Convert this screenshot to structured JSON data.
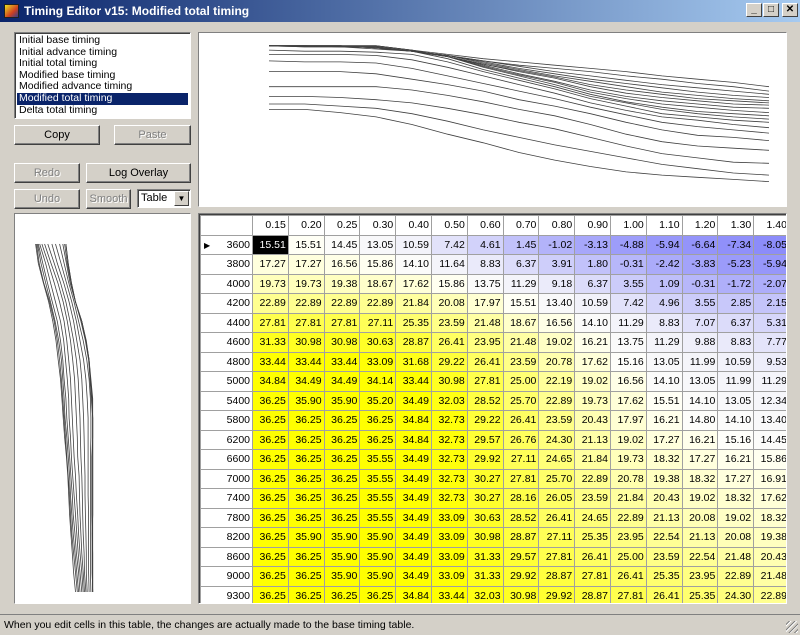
{
  "window": {
    "title": "Timing Editor v15: Modified total timing",
    "minimize_label": "_",
    "maximize_label": "□",
    "close_label": "✕"
  },
  "list": {
    "items": [
      {
        "label": "Initial base timing",
        "selected": false
      },
      {
        "label": "Initial advance timing",
        "selected": false
      },
      {
        "label": "Initial total timing",
        "selected": false
      },
      {
        "label": "Modified base timing",
        "selected": false
      },
      {
        "label": "Modified advance timing",
        "selected": false
      },
      {
        "label": "Modified total timing",
        "selected": true
      },
      {
        "label": "Delta total timing",
        "selected": false
      }
    ]
  },
  "buttons": {
    "copy": "Copy",
    "paste": "Paste",
    "redo": "Redo",
    "log_overlay": "Log Overlay",
    "undo": "Undo",
    "smooth": "Smooth"
  },
  "view_select": {
    "value": "Table"
  },
  "table": {
    "columns": [
      "0.15",
      "0.20",
      "0.25",
      "0.30",
      "0.40",
      "0.50",
      "0.60",
      "0.70",
      "0.80",
      "0.90",
      "1.00",
      "1.10",
      "1.20",
      "1.30",
      "1.40"
    ],
    "current_row_marker": "▶",
    "rows": [
      {
        "rpm": "3600",
        "values": [
          15.51,
          15.51,
          14.45,
          13.05,
          10.59,
          7.42,
          4.61,
          1.45,
          -1.02,
          -3.13,
          -4.88,
          -5.94,
          -6.64,
          -7.34,
          -8.05
        ]
      },
      {
        "rpm": "3800",
        "values": [
          17.27,
          17.27,
          16.56,
          15.86,
          14.1,
          11.64,
          8.83,
          6.37,
          3.91,
          1.8,
          -0.31,
          -2.42,
          -3.83,
          -5.23,
          -5.94
        ]
      },
      {
        "rpm": "4000",
        "values": [
          19.73,
          19.73,
          19.38,
          18.67,
          17.62,
          15.86,
          13.75,
          11.29,
          9.18,
          6.37,
          3.55,
          1.09,
          -0.31,
          -1.72,
          -2.07
        ]
      },
      {
        "rpm": "4200",
        "values": [
          22.89,
          22.89,
          22.89,
          22.89,
          21.84,
          20.08,
          17.97,
          15.51,
          13.4,
          10.59,
          7.42,
          4.96,
          3.55,
          2.85,
          2.15
        ]
      },
      {
        "rpm": "4400",
        "values": [
          27.81,
          27.81,
          27.81,
          27.11,
          25.35,
          23.59,
          21.48,
          18.67,
          16.56,
          14.1,
          11.29,
          8.83,
          7.07,
          6.37,
          5.31
        ]
      },
      {
        "rpm": "4600",
        "values": [
          31.33,
          30.98,
          30.98,
          30.63,
          28.87,
          26.41,
          23.95,
          21.48,
          19.02,
          16.21,
          13.75,
          11.29,
          9.88,
          8.83,
          7.77
        ]
      },
      {
        "rpm": "4800",
        "values": [
          33.44,
          33.44,
          33.44,
          33.09,
          31.68,
          29.22,
          26.41,
          23.59,
          20.78,
          17.62,
          15.16,
          13.05,
          11.99,
          10.59,
          9.53
        ]
      },
      {
        "rpm": "5000",
        "values": [
          34.84,
          34.49,
          34.49,
          34.14,
          33.44,
          30.98,
          27.81,
          25.0,
          22.19,
          19.02,
          16.56,
          14.1,
          13.05,
          11.99,
          11.29
        ]
      },
      {
        "rpm": "5400",
        "values": [
          36.25,
          35.9,
          35.9,
          35.2,
          34.49,
          32.03,
          28.52,
          25.7,
          22.89,
          19.73,
          17.62,
          15.51,
          14.1,
          13.05,
          12.34
        ]
      },
      {
        "rpm": "5800",
        "values": [
          36.25,
          36.25,
          36.25,
          36.25,
          34.84,
          32.73,
          29.22,
          26.41,
          23.59,
          20.43,
          17.97,
          16.21,
          14.8,
          14.1,
          13.4
        ]
      },
      {
        "rpm": "6200",
        "values": [
          36.25,
          36.25,
          36.25,
          36.25,
          34.84,
          32.73,
          29.57,
          26.76,
          24.3,
          21.13,
          19.02,
          17.27,
          16.21,
          15.16,
          14.45
        ]
      },
      {
        "rpm": "6600",
        "values": [
          36.25,
          36.25,
          36.25,
          35.55,
          34.49,
          32.73,
          29.92,
          27.11,
          24.65,
          21.84,
          19.73,
          18.32,
          17.27,
          16.21,
          15.86
        ]
      },
      {
        "rpm": "7000",
        "values": [
          36.25,
          36.25,
          36.25,
          35.55,
          34.49,
          32.73,
          30.27,
          27.81,
          25.7,
          22.89,
          20.78,
          19.38,
          18.32,
          17.27,
          16.91
        ]
      },
      {
        "rpm": "7400",
        "values": [
          36.25,
          36.25,
          36.25,
          35.55,
          34.49,
          32.73,
          30.27,
          28.16,
          26.05,
          23.59,
          21.84,
          20.43,
          19.02,
          18.32,
          17.62
        ]
      },
      {
        "rpm": "7800",
        "values": [
          36.25,
          36.25,
          36.25,
          35.55,
          34.49,
          33.09,
          30.63,
          28.52,
          26.41,
          24.65,
          22.89,
          21.13,
          20.08,
          19.02,
          18.32
        ]
      },
      {
        "rpm": "8200",
        "values": [
          36.25,
          35.9,
          35.9,
          35.9,
          34.49,
          33.09,
          30.98,
          28.87,
          27.11,
          25.35,
          23.95,
          22.54,
          21.13,
          20.08,
          19.38
        ]
      },
      {
        "rpm": "8600",
        "values": [
          36.25,
          36.25,
          35.9,
          35.9,
          34.49,
          33.09,
          31.33,
          29.57,
          27.81,
          26.41,
          25.0,
          23.59,
          22.54,
          21.48,
          20.43
        ]
      },
      {
        "rpm": "9000",
        "values": [
          36.25,
          36.25,
          35.9,
          35.9,
          34.49,
          33.09,
          31.33,
          29.92,
          28.87,
          27.81,
          26.41,
          25.35,
          23.95,
          22.89,
          21.48
        ]
      },
      {
        "rpm": "9300",
        "values": [
          36.25,
          36.25,
          36.25,
          36.25,
          34.84,
          33.44,
          32.03,
          30.98,
          29.92,
          28.87,
          27.81,
          26.41,
          25.35,
          24.3,
          22.89
        ]
      }
    ]
  },
  "status": {
    "text": "When you edit cells in this table, the changes are actually made to the base timing table."
  }
}
